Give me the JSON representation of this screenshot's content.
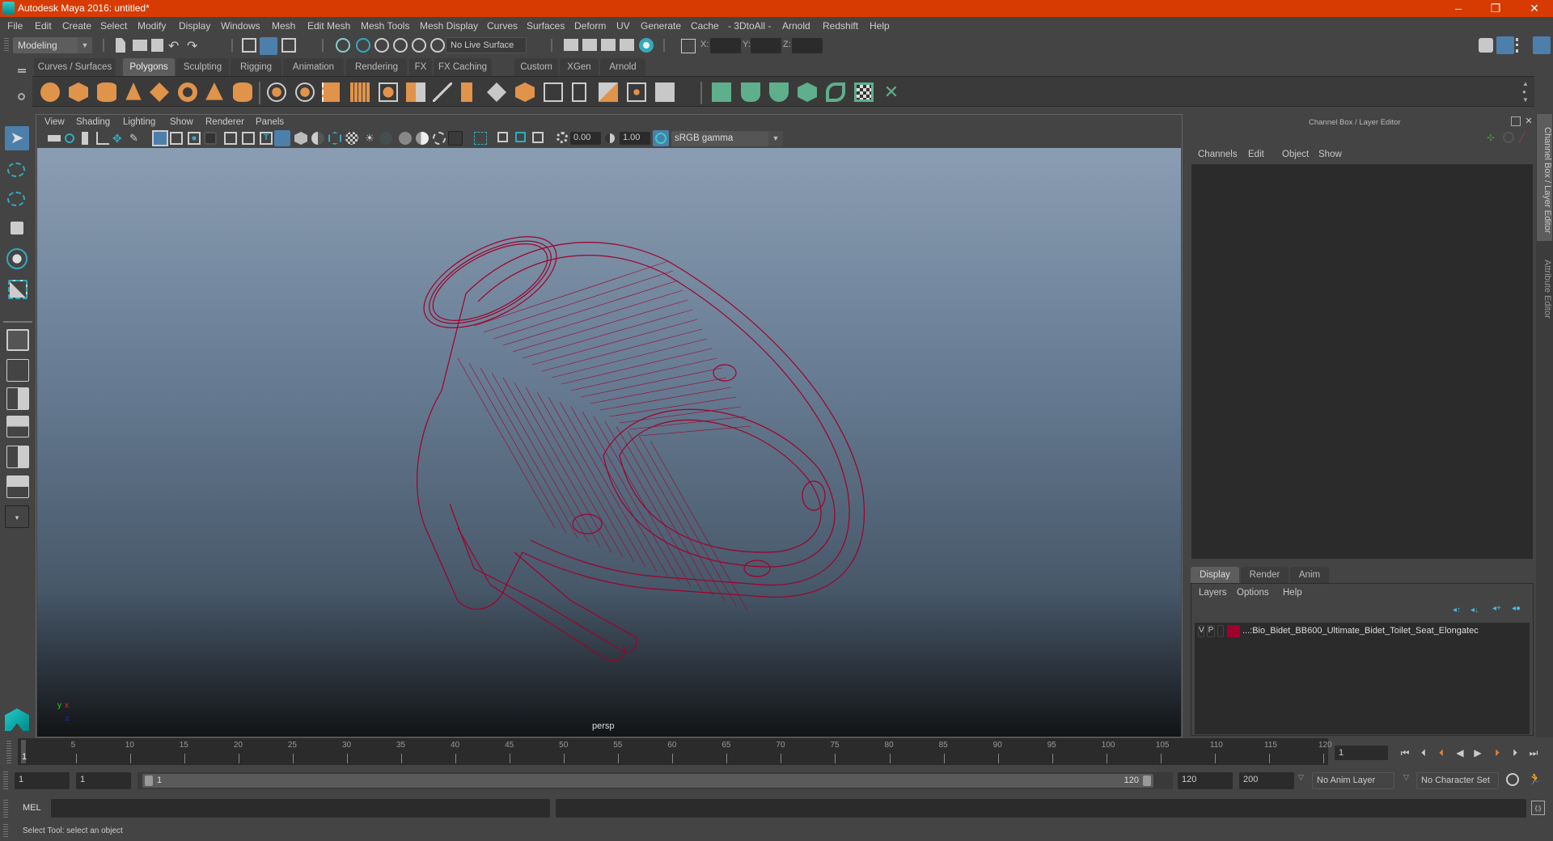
{
  "window": {
    "title": "Autodesk Maya 2016: untitled*",
    "controls": {
      "minimize": "–",
      "maximize": "❐",
      "close": "✕"
    }
  },
  "menubar": [
    "File",
    "Edit",
    "Create",
    "Select",
    "Modify",
    "Display",
    "Windows",
    "Mesh",
    "Edit Mesh",
    "Mesh Tools",
    "Mesh Display",
    "Curves",
    "Surfaces",
    "Deform",
    "UV",
    "Generate",
    "Cache",
    "- 3DtoAll -",
    "Arnold",
    "Redshift",
    "Help"
  ],
  "statusline": {
    "mode": "Modeling",
    "live_surface": "No Live Surface",
    "x_label": "X:",
    "y_label": "Y:",
    "z_label": "Z:",
    "x_value": "",
    "y_value": "",
    "z_value": ""
  },
  "shelf": {
    "tabs": [
      "Curves / Surfaces",
      "Polygons",
      "Sculpting",
      "Rigging",
      "Animation",
      "Rendering",
      "FX",
      "FX Caching",
      "Custom",
      "XGen",
      "Arnold"
    ],
    "active_tab": "Polygons",
    "icons": [
      "poly-sphere",
      "poly-cube",
      "poly-cylinder",
      "poly-cone",
      "poly-plane",
      "poly-torus",
      "poly-pyramid",
      "poly-pipe",
      "combine",
      "separate",
      "mirror",
      "smooth",
      "extract",
      "bridge-merge",
      "multi-cut",
      "target-weld",
      "bevel",
      "extrude",
      "insert-edge-loop",
      "append",
      "bridge",
      "fill-hole",
      "quadrangulate",
      "planar-uv",
      "cylindrical-uv",
      "spherical-uv",
      "automatic-uv",
      "unfold-uv",
      "uv-editor",
      "layout-uv"
    ]
  },
  "viewport": {
    "menu": [
      "View",
      "Shading",
      "Lighting",
      "Show",
      "Renderer",
      "Panels"
    ],
    "exposure": "0.00",
    "gamma": "1.00",
    "color_space": "sRGB gamma",
    "camera_label": "persp",
    "axis": {
      "y": "y",
      "x": "x",
      "z": "z"
    },
    "object_color": "#a0002c"
  },
  "channel_box": {
    "title": "Channel Box / Layer Editor",
    "menu": [
      "Channels",
      "Edit",
      "Object",
      "Show"
    ]
  },
  "layer_editor": {
    "tabs": [
      "Display",
      "Render",
      "Anim"
    ],
    "active_tab": "Display",
    "menu": [
      "Layers",
      "Options",
      "Help"
    ],
    "layers": [
      {
        "v": "V",
        "p": "P",
        "color": "#a0002c",
        "name": "...:Bio_Bidet_BB600_Ultimate_Bidet_Toilet_Seat_Elongatec"
      }
    ]
  },
  "side_tabs": [
    "Channel Box / Layer Editor",
    "Attribute Editor"
  ],
  "timeline": {
    "ticks": [
      5,
      10,
      15,
      20,
      25,
      30,
      35,
      40,
      45,
      50,
      55,
      60,
      65,
      70,
      75,
      80,
      85,
      90,
      95,
      100,
      105,
      110,
      115,
      120
    ],
    "current_frame_marker": "1",
    "current_frame": "1"
  },
  "range": {
    "start": "1",
    "playback_start": "1",
    "slider_start": "1",
    "slider_end": "120",
    "playback_end": "120",
    "end": "200",
    "anim_layer": "No Anim Layer",
    "character_set": "No Character Set"
  },
  "command_line": {
    "label": "MEL",
    "value": "",
    "result": ""
  },
  "help_line": "Select Tool: select an object"
}
